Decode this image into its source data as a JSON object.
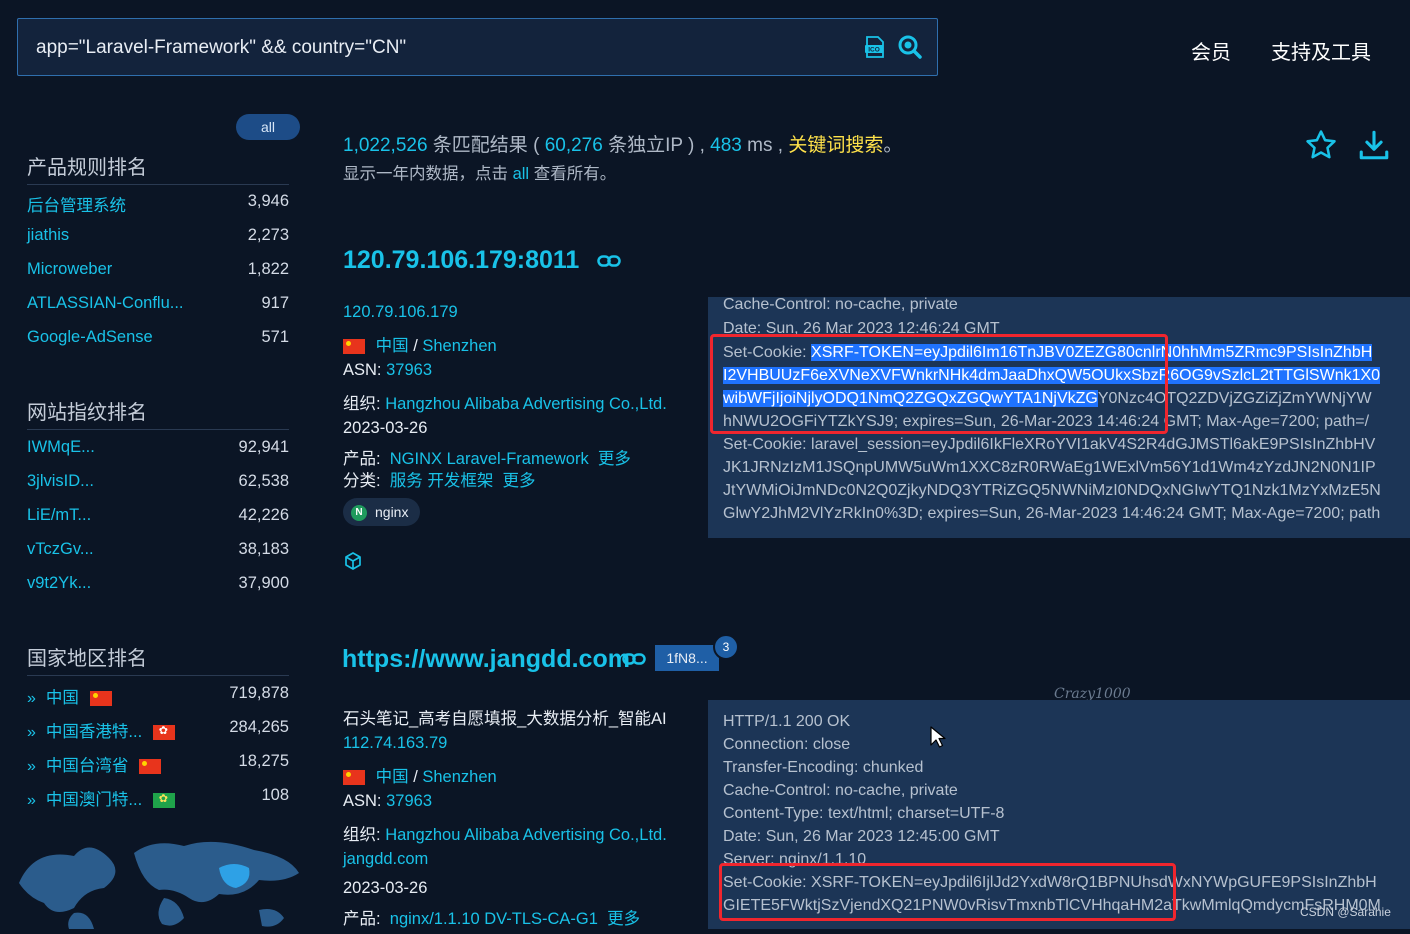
{
  "search": {
    "value": "app=\"Laravel-Framework\" && country=\"CN\"",
    "ico_label": "ICO"
  },
  "nav": {
    "member": "会员",
    "tools": "支持及工具"
  },
  "sidebar": {
    "all_label": "all",
    "product_title": "产品规则排名",
    "products": [
      {
        "label": "后台管理系统",
        "count": "3,946"
      },
      {
        "label": "jiathis",
        "count": "2,273"
      },
      {
        "label": "Microweber",
        "count": "1,822"
      },
      {
        "label": "ATLASSIAN-Conflu...",
        "count": "917"
      },
      {
        "label": "Google-AdSense",
        "count": "571"
      }
    ],
    "fingerprint_title": "网站指纹排名",
    "fingerprints": [
      {
        "label": "IWMqE...",
        "count": "92,941"
      },
      {
        "label": "3jlvisID...",
        "count": "62,538"
      },
      {
        "label": "LiE/mT...",
        "count": "42,226"
      },
      {
        "label": "vTczGv...",
        "count": "38,183"
      },
      {
        "label": "v9t2Yk...",
        "count": "37,900"
      }
    ],
    "country_title": "国家地区排名",
    "countries": [
      {
        "label": "中国",
        "count": "719,878",
        "flag": "cn"
      },
      {
        "label": "中国香港特...",
        "count": "284,265",
        "flag": "hk"
      },
      {
        "label": "中国台湾省",
        "count": "18,275",
        "flag": "cn"
      },
      {
        "label": "中国澳门特...",
        "count": "108",
        "flag": "mo"
      }
    ]
  },
  "summary": {
    "total": "1,022,526",
    "t1": " 条匹配结果 ( ",
    "unique_ip": "60,276",
    "t2": " 条独立IP ) , ",
    "ms": "483",
    "t3": " ms , ",
    "keyword": "关键词搜索",
    "t4": "。",
    "sub1": "显示一年内数据，点击 ",
    "sub_all": "all",
    "sub2": " 查看所有。"
  },
  "result1": {
    "title": "120.79.106.179:8011",
    "ip": "120.79.106.179",
    "country": "中国",
    "sep": "/",
    "city": "Shenzhen",
    "asn_label": "ASN:",
    "asn": "37963",
    "org_label": "组织:",
    "org": "Hangzhou Alibaba Advertising Co.,Ltd.",
    "date": "2023-03-26",
    "product_label": "产品:",
    "product": "NGINX Laravel-Framework",
    "more": "更多",
    "category_label": "分类:",
    "category": "服务 开发框架",
    "tag": "nginx",
    "headers": [
      "Cache-Control: no-cache, private",
      "Date: Sun, 26 Mar 2023 12:46:24 GMT"
    ],
    "cookie_prefix": "Set-Cookie: ",
    "cookie_hl1": "XSRF-TOKEN=eyJpdil6Im16TnJBV0ZEZG80cnlrN0hhMm5ZRmc9PSIsInZhbH",
    "cookie_hl2": "I2VHBUUzF6eXVNeXVFWnkrNHk4dmJaaDhxQW5OUkxSbzR6OG9vSzlcL2tTTGlSWnk1X0",
    "cookie_hl3": "wibWFjIjoiNjlyODQ1NmQ2ZGQxZGQwYTA1NjVkZG",
    "cookie_rest3": "Y0Nzc4OTQ2ZDVjZGZiZjZmYWNjYW",
    "cookie_line4": "hNWU2OGFiYTZkYSJ9; expires=Sun, 26-Mar-2023 14:46:24 GMT; Max-Age=7200; path=/",
    "session_lines": [
      "Set-Cookie: laravel_session=eyJpdil6IkFleXRoYVI1akV4S2R4dGJMSTl6akE9PSIsInZhbHV",
      "JK1JRNzIzM1JSQnpUMW5uWm1XXC8zR0RWaEg1WExlVm56Y1d1Wm4zYzdJN2N0N1IP",
      "JtYWMiOiJmNDc0N2Q0ZjkyNDQ3YTRiZGQ5NWNiMzI0NDQxNGIwYTQ1Nzk1MzYxMzE5N",
      "GlwY2JhM2VlYzRkIn0%3D; expires=Sun, 26-Mar-2023 14:46:24 GMT; Max-Age=7200; path"
    ]
  },
  "result2": {
    "title": "https://www.jangdd.com",
    "hash_badge": "1fN8...",
    "badge_count": "3",
    "site_title": "石头笔记_高考自愿填报_大数据分析_智能AI",
    "ip": "112.74.163.79",
    "country": "中国",
    "sep": "/",
    "city": "Shenzhen",
    "asn_label": "ASN:",
    "asn": "37963",
    "org_label": "组织:",
    "org": "Hangzhou Alibaba Advertising Co.,Ltd.",
    "domain": "jangdd.com",
    "date": "2023-03-26",
    "product_label": "产品:",
    "product": "nginx/1.1.10 DV-TLS-CA-G1",
    "more": "更多",
    "headers": [
      "HTTP/1.1 200 OK",
      "Connection: close",
      "Transfer-Encoding: chunked",
      "Cache-Control: no-cache, private",
      "Content-Type: text/html; charset=UTF-8",
      "Date: Sun, 26 Mar 2023 12:45:00 GMT",
      "Server: nginx/1.1.10",
      "Set-Cookie: XSRF-TOKEN=eyJpdil6IjlJd2YxdW8rQ1BPNUhsdWxNYWpGUFE9PSIsInZhbH",
      "GIETE5FWktjSzVjendXQ21PNW0vRisvTmxnbTlCVHhqaHM2aTkwMmlqQmdycmFsRHM0M"
    ]
  },
  "signature": "Crazy1000",
  "watermark": "CSDN @Sarahie"
}
